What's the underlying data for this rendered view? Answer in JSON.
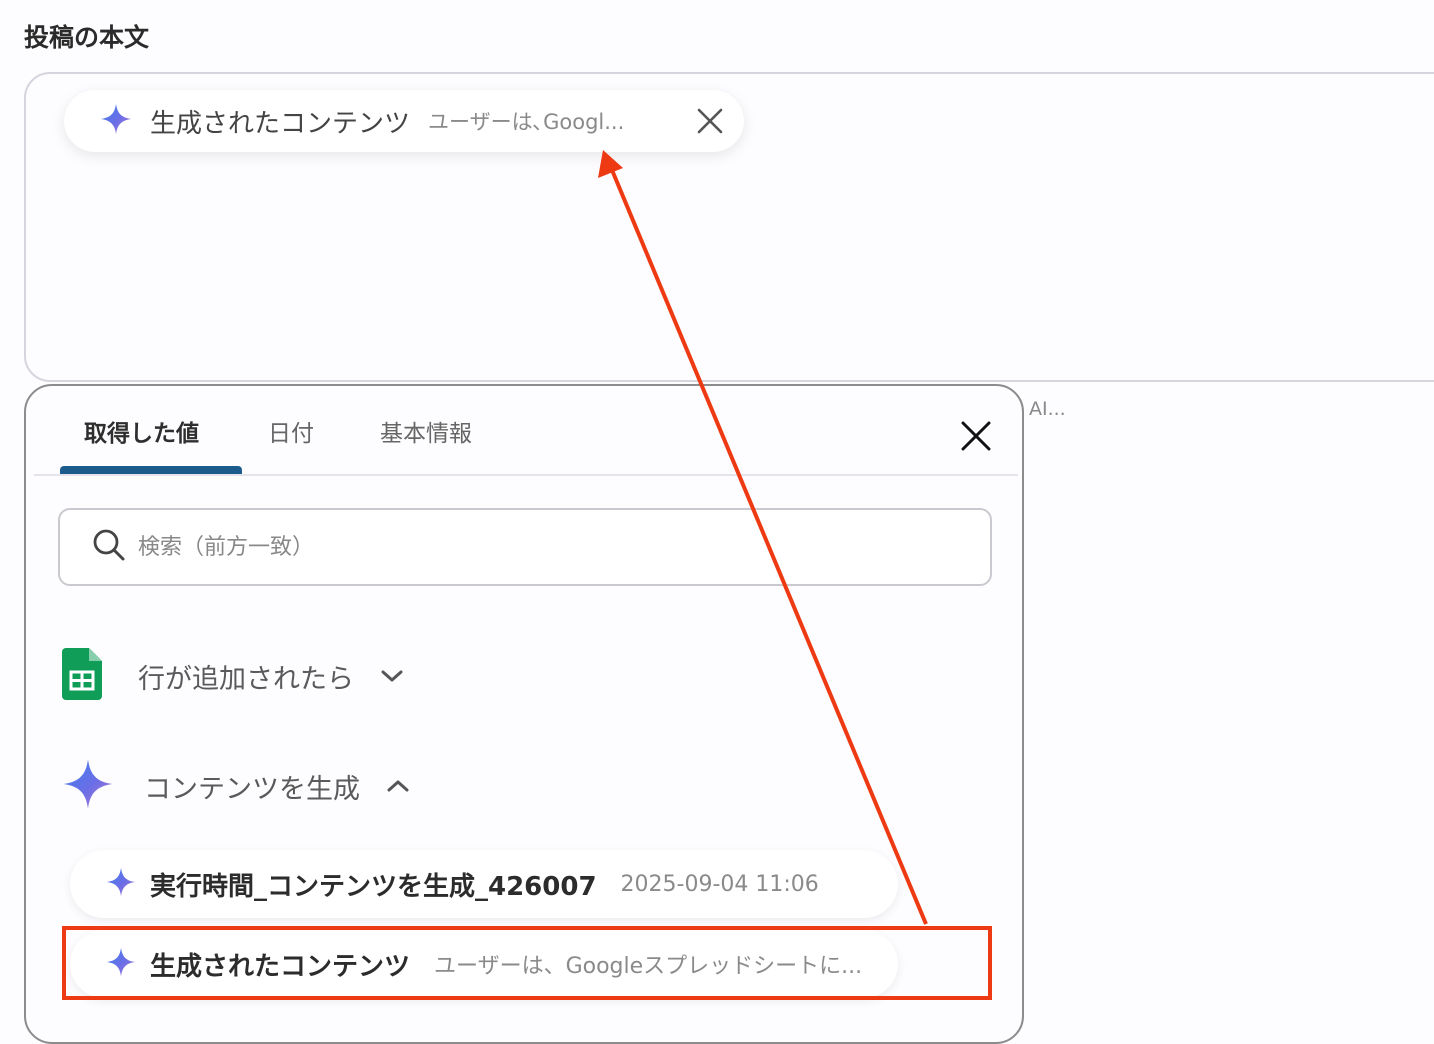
{
  "field": {
    "label": "投稿の本文",
    "chip": {
      "title": "生成されたコンテンツ",
      "value": "ユーザーは､Googl...",
      "icon": "sparkle-icon",
      "remove_icon": "close-icon"
    },
    "side_hint": "AI..."
  },
  "picker": {
    "tabs": [
      {
        "label": "取得した値",
        "active": true
      },
      {
        "label": "日付",
        "active": false
      },
      {
        "label": "基本情報",
        "active": false
      }
    ],
    "search": {
      "placeholder": "検索（前方一致）",
      "value": ""
    },
    "groups": [
      {
        "label": "行が追加されたら",
        "icon": "google-sheets-icon",
        "expanded": false
      },
      {
        "label": "コンテンツを生成",
        "icon": "sparkle-icon",
        "expanded": true,
        "items": [
          {
            "title": "実行時間_コンテンツを生成_426007",
            "meta": "2025-09-04 11:06"
          },
          {
            "title": "生成されたコンテンツ",
            "meta": "ユーザーは、Googleスプレッドシートに..."
          }
        ]
      }
    ]
  },
  "colors": {
    "annotation": "#ee3a12",
    "tab_accent": "#1b5c8d",
    "sheets_green": "#0f9d58"
  }
}
